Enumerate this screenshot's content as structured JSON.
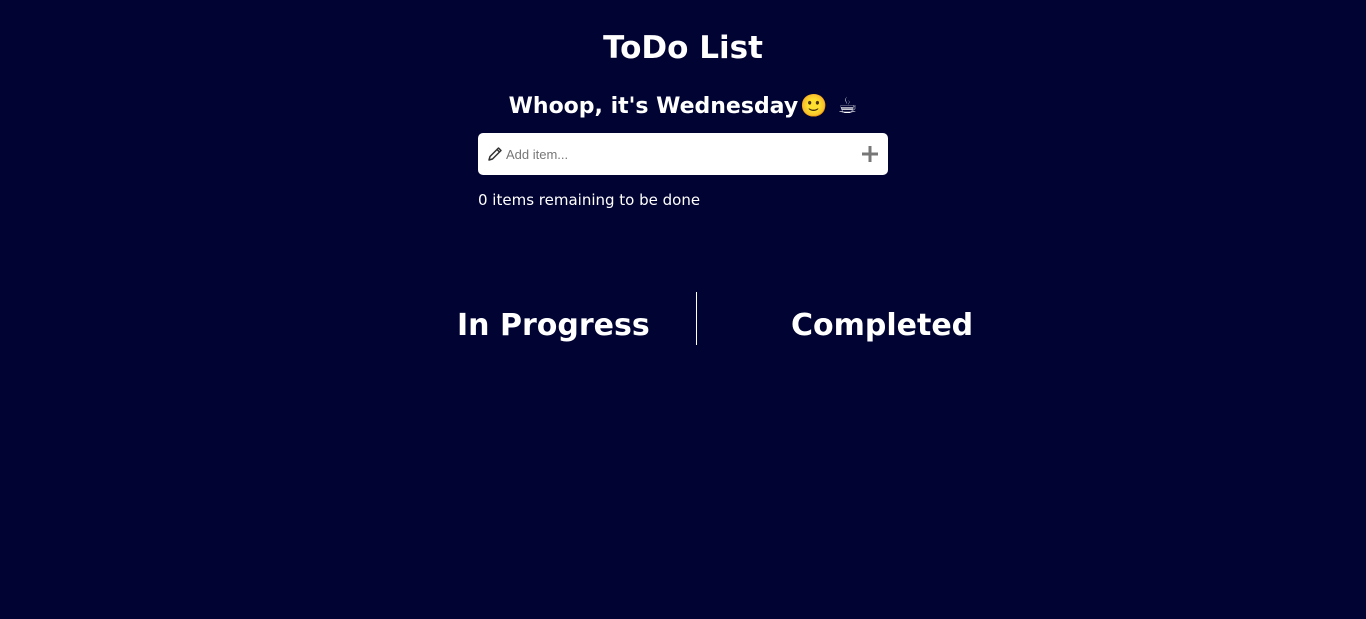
{
  "app": {
    "title": "ToDo List",
    "greeting": "Whoop, it's Wednesday",
    "greeting_emoji": "🙂",
    "greeting_cup": "☕"
  },
  "add_item": {
    "placeholder": "Add item...",
    "value": "",
    "icon_left": "pencil-icon",
    "icon_right": "plus-icon"
  },
  "status": {
    "remaining_text": "0 items remaining to be done"
  },
  "columns": {
    "in_progress": "In Progress",
    "completed": "Completed"
  },
  "colors": {
    "background": "#010333",
    "text": "#ffffff",
    "input_background": "#ffffff",
    "icon_gray": "#777777"
  }
}
